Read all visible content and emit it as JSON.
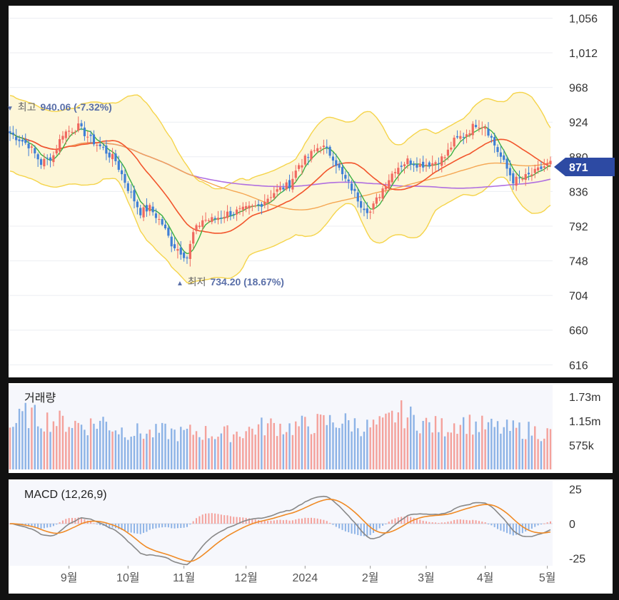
{
  "chart_data": {
    "type": "candlestick",
    "price_panel": {
      "y_ticks": [
        "1,056",
        "1,012",
        "968",
        "924",
        "880",
        "836",
        "792",
        "748",
        "704",
        "660",
        "616"
      ],
      "ylim": [
        600,
        1070
      ],
      "current_price": "871",
      "annotations": {
        "high_marker": "▼",
        "high_label": "최고",
        "high_value": "940.06 (-7.32%)",
        "low_marker": "▲",
        "low_label": "최저",
        "low_value": "734.20 (18.67%)"
      },
      "colors": {
        "up": "#f0685f",
        "down": "#3f7fd6",
        "ma5": "#3cb043",
        "ma20": "#f2552c",
        "ma60": "#f5a652",
        "ma120": "#b06fe0",
        "band_fill": "#fdf6d8",
        "band_line": "#f5d44a",
        "price_tag": "#2d4aa3"
      },
      "close_anchors": [
        [
          0,
          910
        ],
        [
          6,
          895
        ],
        [
          10,
          872
        ],
        [
          14,
          882
        ],
        [
          17,
          910
        ],
        [
          22,
          918
        ],
        [
          26,
          902
        ],
        [
          30,
          890
        ],
        [
          34,
          875
        ],
        [
          38,
          840
        ],
        [
          42,
          810
        ],
        [
          45,
          815
        ],
        [
          49,
          795
        ],
        [
          52,
          770
        ],
        [
          55,
          760
        ],
        [
          57,
          752
        ],
        [
          59,
          783
        ],
        [
          62,
          800
        ],
        [
          65,
          800
        ],
        [
          70,
          808
        ],
        [
          75,
          812
        ],
        [
          80,
          818
        ],
        [
          85,
          835
        ],
        [
          90,
          845
        ],
        [
          93,
          870
        ],
        [
          96,
          880
        ],
        [
          100,
          895
        ],
        [
          104,
          880
        ],
        [
          107,
          856
        ],
        [
          110,
          840
        ],
        [
          113,
          820
        ],
        [
          116,
          810
        ],
        [
          120,
          840
        ],
        [
          124,
          865
        ],
        [
          128,
          875
        ],
        [
          132,
          870
        ],
        [
          136,
          872
        ],
        [
          140,
          880
        ],
        [
          143,
          900
        ],
        [
          147,
          910
        ],
        [
          150,
          922
        ],
        [
          153,
          920
        ],
        [
          156,
          895
        ],
        [
          159,
          872
        ],
        [
          162,
          850
        ],
        [
          165,
          852
        ],
        [
          169,
          860
        ],
        [
          172,
          868
        ],
        [
          174,
          872
        ]
      ],
      "n_candles": 175
    },
    "volume_panel": {
      "title": "거래량",
      "y_ticks": [
        "1.73m",
        "1.15m",
        "575k"
      ],
      "ylim": [
        0,
        2000000
      ],
      "anchors": [
        [
          0,
          1000000
        ],
        [
          5,
          1300000
        ],
        [
          10,
          1200000
        ],
        [
          15,
          1150000
        ],
        [
          20,
          1100000
        ],
        [
          25,
          1050000
        ],
        [
          30,
          1150000
        ],
        [
          35,
          950000
        ],
        [
          40,
          900000
        ],
        [
          45,
          850000
        ],
        [
          50,
          900000
        ],
        [
          55,
          850000
        ],
        [
          60,
          900000
        ],
        [
          65,
          850000
        ],
        [
          70,
          850000
        ],
        [
          75,
          900000
        ],
        [
          80,
          1000000
        ],
        [
          85,
          1050000
        ],
        [
          90,
          1000000
        ],
        [
          95,
          1050000
        ],
        [
          100,
          1100000
        ],
        [
          105,
          1150000
        ],
        [
          110,
          1100000
        ],
        [
          115,
          1000000
        ],
        [
          120,
          1050000
        ],
        [
          125,
          1350000
        ],
        [
          130,
          1200000
        ],
        [
          135,
          1050000
        ],
        [
          140,
          1000000
        ],
        [
          145,
          1150000
        ],
        [
          150,
          1050000
        ],
        [
          155,
          1000000
        ],
        [
          160,
          950000
        ],
        [
          165,
          950000
        ],
        [
          170,
          900000
        ],
        [
          174,
          850000
        ]
      ]
    },
    "macd_panel": {
      "title": "MACD (12,26,9)",
      "y_ticks": [
        "25",
        "0",
        "-25"
      ],
      "ylim": [
        -30,
        30
      ],
      "colors": {
        "macd": "#888888",
        "signal": "#f08a24",
        "hist_up": "#f0685f",
        "hist_down": "#3f7fd6"
      }
    },
    "x_axis": {
      "labels": [
        {
          "text": "9월",
          "i": 19
        },
        {
          "text": "10월",
          "i": 38
        },
        {
          "text": "11월",
          "i": 56
        },
        {
          "text": "12월",
          "i": 76
        },
        {
          "text": "2024",
          "i": 95
        },
        {
          "text": "2월",
          "i": 116
        },
        {
          "text": "3월",
          "i": 134
        },
        {
          "text": "4월",
          "i": 153
        },
        {
          "text": "5월",
          "i": 173
        }
      ]
    }
  }
}
